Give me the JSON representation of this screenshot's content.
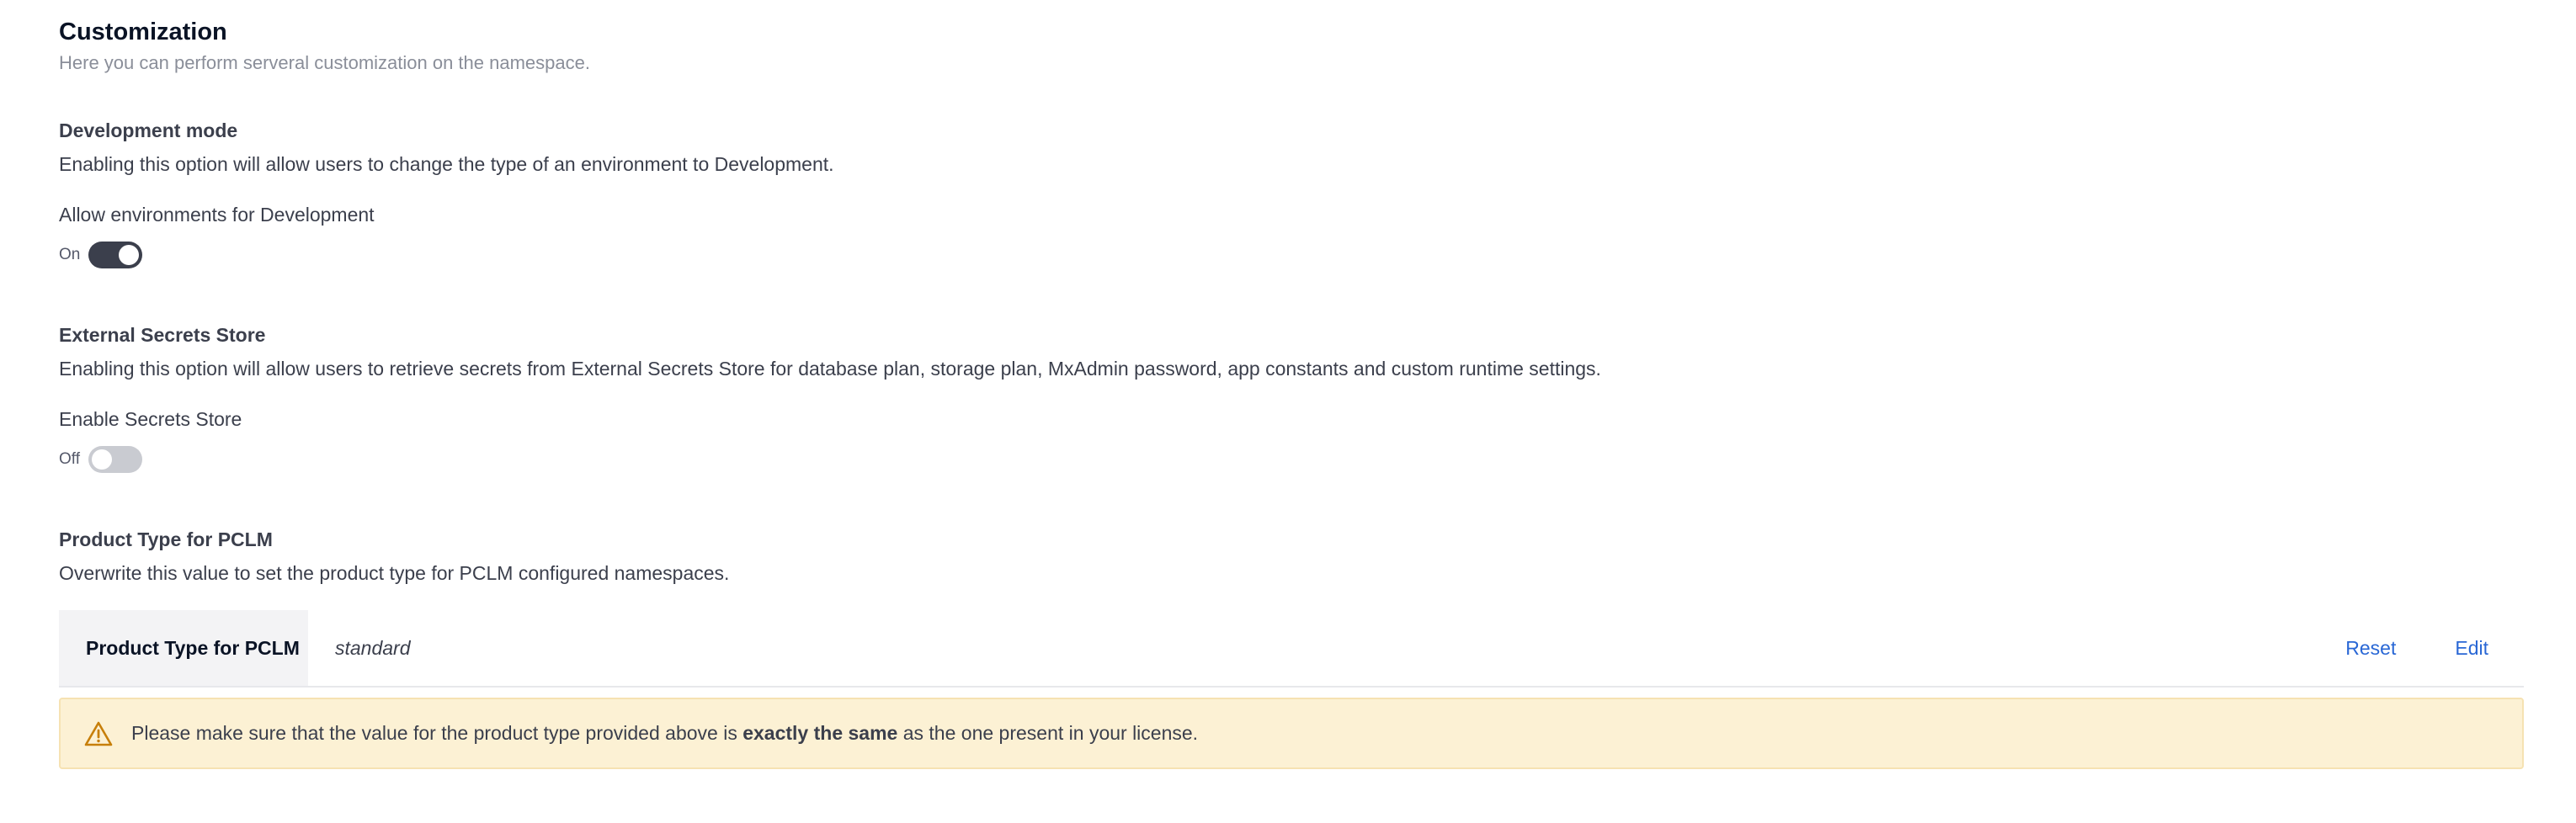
{
  "header": {
    "title": "Customization",
    "subtitle": "Here you can perform serveral customization on the namespace."
  },
  "development_mode": {
    "title": "Development mode",
    "description": "Enabling this option will allow users to change the type of an environment to Development.",
    "field_label": "Allow environments for Development",
    "toggle_state": "On"
  },
  "external_secrets": {
    "title": "External Secrets Store",
    "description": "Enabling this option will allow users to retrieve secrets from External Secrets Store for database plan, storage plan, MxAdmin password, app constants and custom runtime settings.",
    "field_label": "Enable Secrets Store",
    "toggle_state": "Off"
  },
  "product_type": {
    "title": "Product Type for PCLM",
    "description": "Overwrite this value to set the product type for PCLM configured namespaces.",
    "row_label": "Product Type for PCLM",
    "row_value": "standard",
    "reset_label": "Reset",
    "edit_label": "Edit"
  },
  "alert": {
    "icon": "warning-icon",
    "text_before": "Please make sure that the value for the product type provided above is ",
    "text_bold": "exactly the same",
    "text_after": " as the one present in your license."
  },
  "colors": {
    "toggle_on": "#3b3f4c",
    "toggle_off": "#c9cbd1",
    "link": "#2967d5",
    "alert_bg": "#fcf1d4",
    "warning": "#c77f0a"
  }
}
